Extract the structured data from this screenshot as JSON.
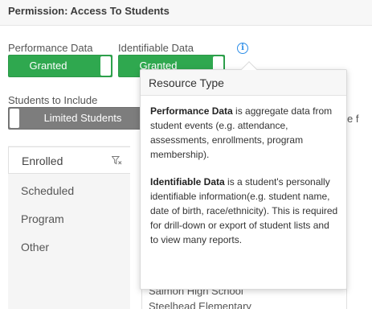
{
  "header": {
    "title": "Permission: Access To Students"
  },
  "permissions": {
    "performance": {
      "label": "Performance Data",
      "value": "Granted"
    },
    "identifiable": {
      "label": "Identifiable Data",
      "value": "Granted"
    }
  },
  "students": {
    "label": "Students to Include",
    "value": "Limited Students",
    "trailing_text": "e f"
  },
  "filter_panel": {
    "selected": "Enrolled",
    "items": [
      "Scheduled",
      "Program",
      "Other"
    ]
  },
  "school_list": {
    "items": [
      "Salmon High School",
      "Steelhead Elementary"
    ]
  },
  "popover": {
    "title": "Resource Type",
    "performance_term": "Performance Data",
    "performance_desc": " is aggregate data from student events (e.g. attendance, assessments, enrollments, program membership).",
    "identifiable_term": "Identifiable Data",
    "identifiable_desc": " is a student's personally identifiable information(e.g. student name, date of birth, race/ethnicity). This is required for drill-down or export of student lists and to view many reports."
  },
  "colors": {
    "granted": "#2fa84f",
    "limited": "#7d7d7d",
    "info": "#2d8ee8"
  }
}
